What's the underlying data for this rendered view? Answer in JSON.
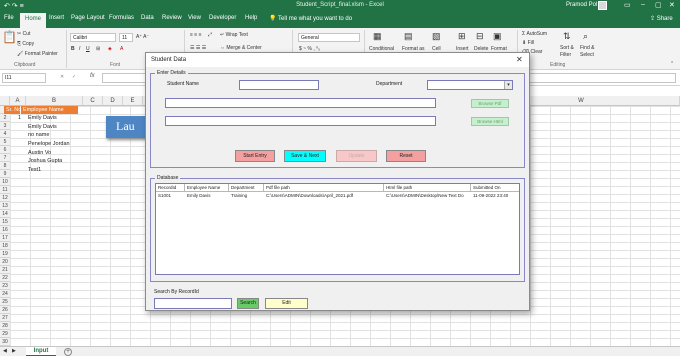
{
  "window": {
    "title": "Student_Script_final.xlsm  -  Excel",
    "user": "Pramod Pol",
    "qat": "↶  ↷  ≡"
  },
  "tabs": [
    "File",
    "Home",
    "Insert",
    "Page Layout",
    "Formulas",
    "Data",
    "Review",
    "View",
    "Developer",
    "Help"
  ],
  "tell_me": "Tell me what you want to do",
  "share": "Share",
  "ribbon": {
    "clipboard": {
      "cut": "Cut",
      "copy": "Copy",
      "format_painter": "Format Painter",
      "group": "Clipboard"
    },
    "font": {
      "name": "Calibri",
      "size": "11",
      "group": "Font"
    },
    "alignment": {
      "wrap_text": "Wrap Text",
      "merge_center": "Merge & Center"
    },
    "number": {
      "format": "General"
    },
    "styles": {
      "conditional": "Conditional",
      "format_as": "Format as",
      "cell": "Cell"
    },
    "cells": {
      "insert": "Insert",
      "delete": "Delete",
      "format": "Format"
    },
    "editing": {
      "autosum": "AutoSum",
      "fill": "Fill",
      "clear": "Clear",
      "sort_filter": "Sort &",
      "filter": "Filter",
      "find_select": "Find &",
      "select": "Select",
      "group": "Editing"
    }
  },
  "formula_bar": {
    "name_box": "I11",
    "fx": "fx"
  },
  "columns": [
    "A",
    "B",
    "C",
    "D",
    "E",
    "F",
    "G",
    "H",
    "I",
    "J",
    "K",
    "L",
    "M",
    "N",
    "O",
    "P",
    "Q",
    "R",
    "S",
    "T",
    "U",
    "V",
    "W"
  ],
  "rows": [
    "1",
    "2",
    "3",
    "4",
    "5",
    "6",
    "7",
    "8",
    "9",
    "10",
    "11",
    "12",
    "13",
    "14",
    "15",
    "16",
    "17",
    "18",
    "19",
    "20",
    "21",
    "22",
    "23",
    "24",
    "25",
    "26",
    "27",
    "28",
    "29",
    "30"
  ],
  "sheet_cells": {
    "header_no": "Sr. No.",
    "header_name": "Employee Name",
    "row_num": "1",
    "names": [
      "Emily Davis",
      "Emily Davis",
      "no name",
      "Penelope Jordan",
      "Austin Vo",
      "Joshua Gupta",
      "Test1"
    ]
  },
  "launch_button": "Lau",
  "sheet_tab": "Input",
  "dialog": {
    "title": "Student Data",
    "close": "✕",
    "enter_details": "Enter Details",
    "student_name_label": "Student Name",
    "department_label": "Department",
    "department_arrow": "▾",
    "browse_pdf": "Browse Pdf",
    "browse_html": "Browse Html",
    "start_entry": "Start Entry",
    "save_next": "Save & Next",
    "update": "Update",
    "reset": "Reset",
    "database_label": "Database",
    "columns": [
      "RecordId",
      "Employee Name",
      "Department",
      "Pdf file path",
      "Html file path",
      "Submitted On"
    ],
    "rows": [
      [
        "S1001",
        "Emily Davis",
        "Training",
        "C:\\Users\\ADMIN\\Downloads\\April_2021.pdf",
        "C:\\Users\\ADMIN\\Desktop\\New Text Do",
        "11-09-2022 23:40"
      ]
    ],
    "search_label": "Search By RecordId",
    "search_button": "Search",
    "edit_button": "Edit"
  },
  "colors": {
    "excel_green": "#217346",
    "header_orange": "#ed7d31",
    "save_next": "#00ffff",
    "start_reset": "#f4a0a0",
    "update": "#f8c8c8",
    "search": "#66cc66",
    "edit": "#ffffcc"
  }
}
